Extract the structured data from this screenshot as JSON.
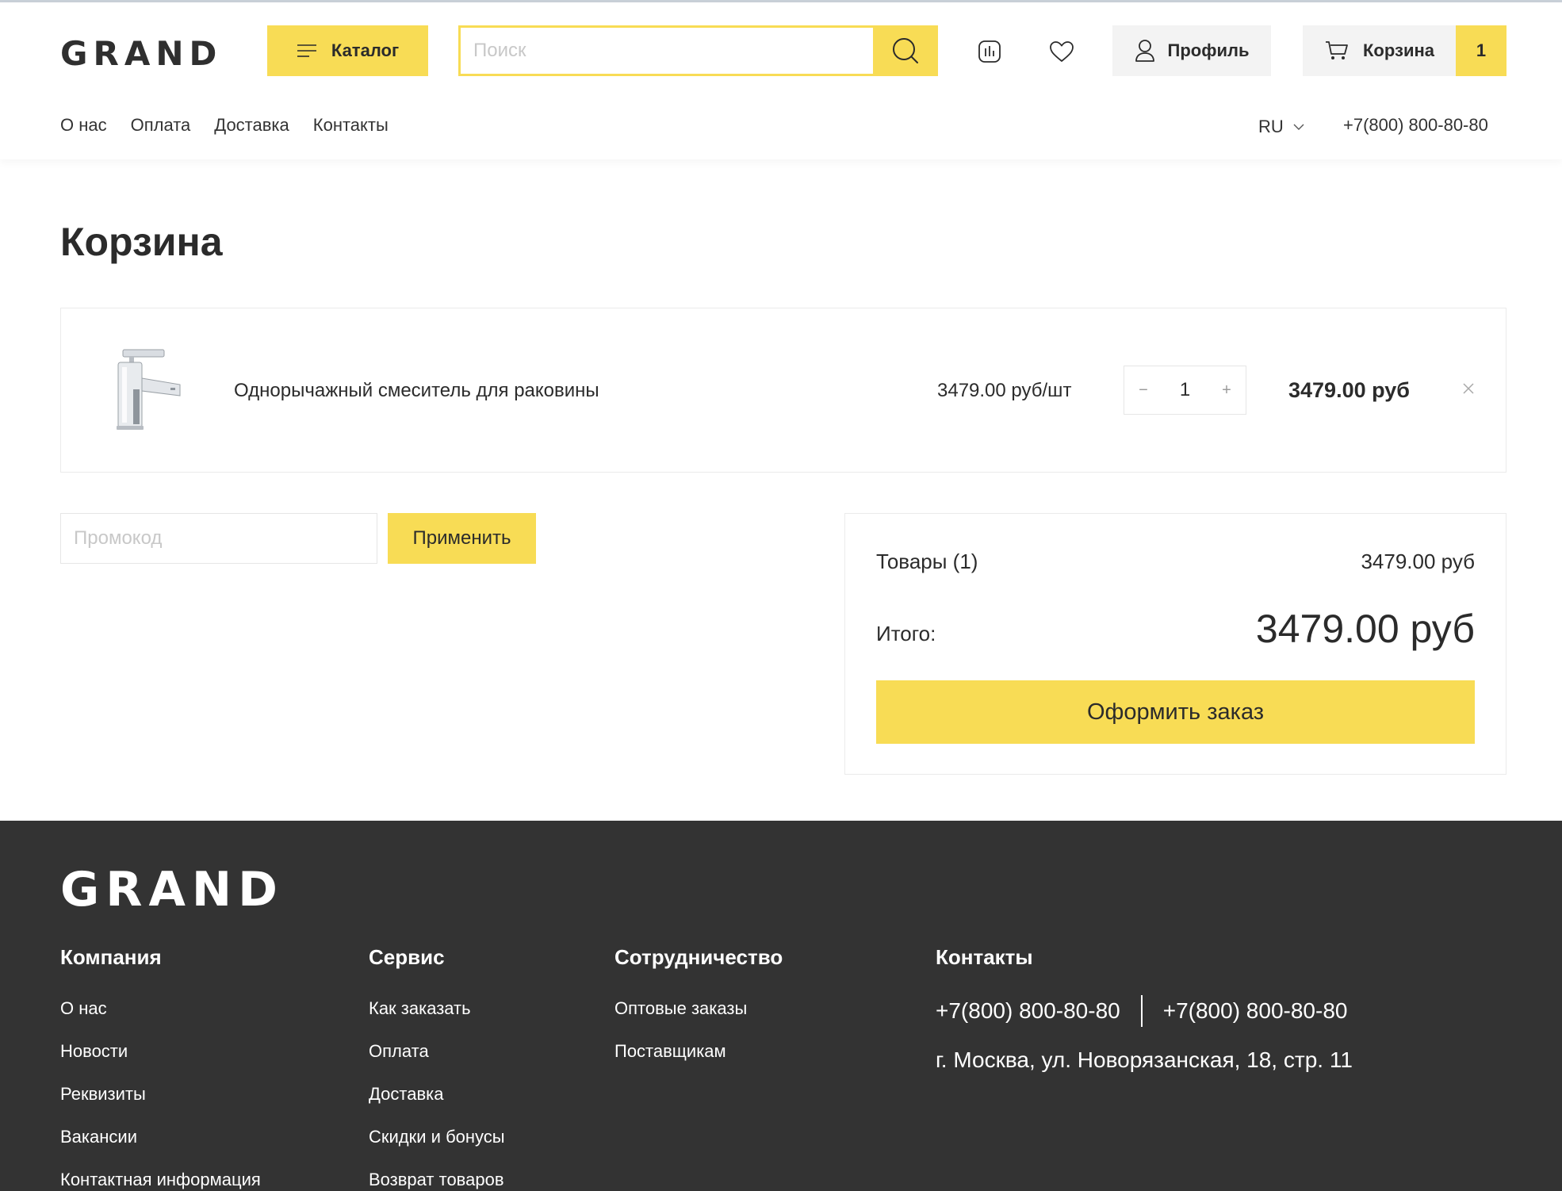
{
  "header": {
    "logo": "GRAND",
    "catalog_label": "Каталог",
    "search_placeholder": "Поиск",
    "profile_label": "Профиль",
    "cart_label": "Корзина",
    "cart_count": "1",
    "nav": [
      "О нас",
      "Оплата",
      "Доставка",
      "Контакты"
    ],
    "language": "RU",
    "phone": "+7(800) 800-80-80"
  },
  "main": {
    "title": "Корзина",
    "item": {
      "name": "Однорычажный смеситель для раковины",
      "unit_price": "3479.00 руб/шт",
      "quantity": "1",
      "minus": "−",
      "plus": "+",
      "total": "3479.00 руб"
    },
    "promo": {
      "placeholder": "Промокод",
      "apply_label": "Применить"
    },
    "summary": {
      "items_label": "Товары (1)",
      "items_value": "3479.00 руб",
      "total_label": "Итого:",
      "total_value": "3479.00 руб",
      "checkout_label": "Оформить заказ"
    }
  },
  "footer": {
    "logo": "GRAND",
    "company": {
      "title": "Компания",
      "links": [
        "О нас",
        "Новости",
        "Реквизиты",
        "Вакансии",
        "Контактная информация"
      ]
    },
    "service": {
      "title": "Сервис",
      "links": [
        "Как заказать",
        "Оплата",
        "Доставка",
        "Скидки и бонусы",
        "Возврат товаров"
      ]
    },
    "partnership": {
      "title": "Сотрудничество",
      "links": [
        "Оптовые заказы",
        "Поставщикам"
      ]
    },
    "contacts": {
      "title": "Контакты",
      "phone1": "+7(800) 800-80-80",
      "phone2": "+7(800) 800-80-80",
      "address": "г. Москва, ул. Новорязанская, 18, стр. 11"
    }
  },
  "colors": {
    "accent": "#f8dc55",
    "text": "#2b2b2b",
    "footer_bg": "#333333"
  }
}
